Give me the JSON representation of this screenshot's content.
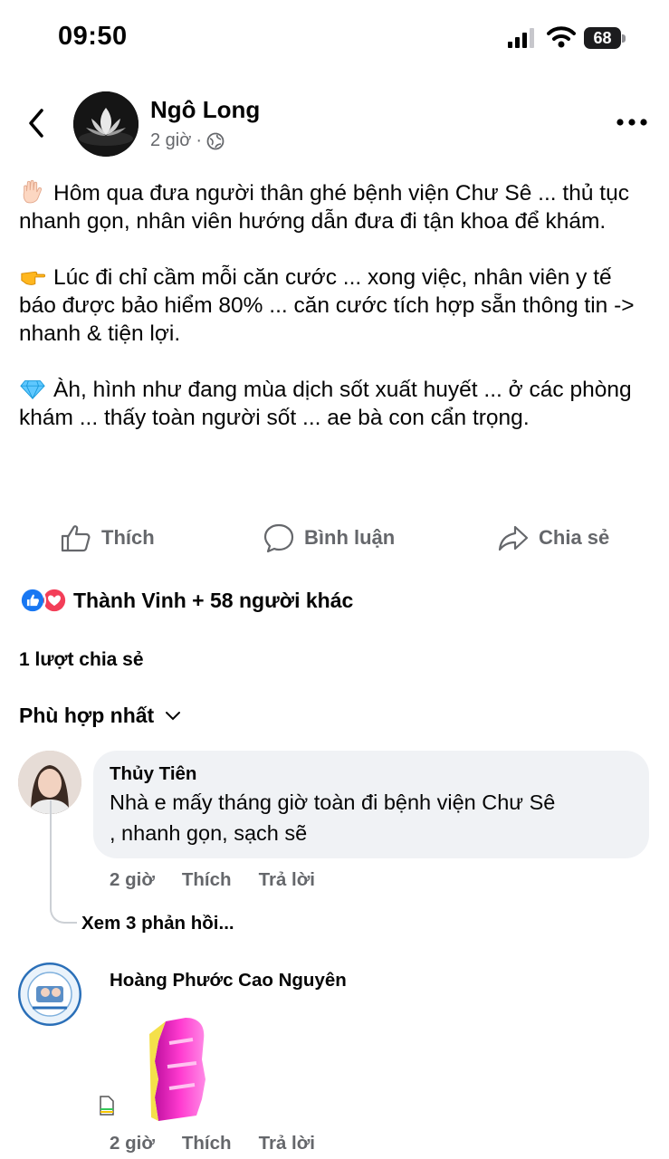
{
  "status_bar": {
    "time": "09:50",
    "battery": "68"
  },
  "post": {
    "author": "Ngô Long",
    "time": "2 giờ",
    "separator": "·",
    "paragraphs": [
      {
        "emoji": "raised-hand-icon",
        "text": "Hôm qua đưa người thân ghé bệnh viện Chư Sê ... thủ tục nhanh gọn, nhân viên hướng dẫn đưa đi tận khoa để khám."
      },
      {
        "emoji": "pointing-hand-icon",
        "text": "Lúc đi chỉ cầm mỗi căn cước ... xong việc, nhân viên y tế báo được bảo hiểm 80% ... căn cước tích hợp sẵn thông tin -> nhanh & tiện lợi."
      },
      {
        "emoji": "gem-icon",
        "text": "Àh, hình như đang mùa dịch sốt xuất huyết ... ở các phòng khám ... thấy toàn người sốt ... ae bà con cẩn trọng."
      }
    ]
  },
  "actions": {
    "like": "Thích",
    "comment": "Bình luận",
    "share": "Chia sẻ"
  },
  "reactions": {
    "text": "Thành Vinh + 58 người khác"
  },
  "shares": "1 lượt chia sẻ",
  "sort_label": "Phù hợp nhất",
  "comments": [
    {
      "name": "Thủy Tiên",
      "text_line1": "Nhà e mấy tháng giờ toàn đi bệnh viện Chư Sê",
      "text_line2": ", nhanh gọn, sạch sẽ",
      "time": "2 giờ",
      "like": "Thích",
      "reply": "Trả lời",
      "view_replies": "Xem 3 phản hồi..."
    },
    {
      "name": "Hoàng Phước Cao Nguyên",
      "time": "2 giờ",
      "like": "Thích",
      "reply": "Trả lời"
    }
  ],
  "colors": {
    "text": "#050505",
    "secondary": "#65676b",
    "like_blue": "#1877f2",
    "love_red": "#f33e58",
    "bubble": "#f0f2f5",
    "sticker_pink": "#ff2fc8"
  }
}
